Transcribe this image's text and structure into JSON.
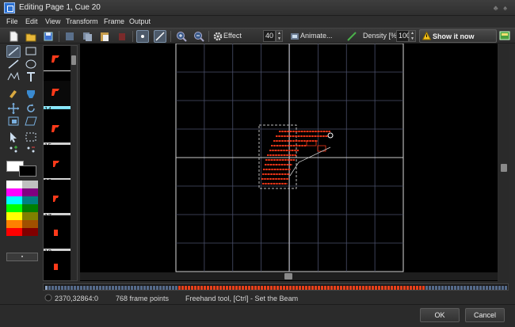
{
  "window": {
    "title": "Editing Page 1, Cue 20"
  },
  "menu": [
    "File",
    "Edit",
    "View",
    "Transform",
    "Frame",
    "Output"
  ],
  "toolbar": {
    "effect_label": "Effect",
    "effect_value": "40",
    "animate_label": "Animate...",
    "density_label": "Density [%]",
    "density_value": "100",
    "show_label": "Show it now"
  },
  "cues": [
    {
      "label": "13",
      "active": false
    },
    {
      "label": "14",
      "active": true
    },
    {
      "label": "15",
      "active": false
    },
    {
      "label": "16",
      "active": false
    },
    {
      "label": "17",
      "active": false
    },
    {
      "label": "18",
      "active": false
    }
  ],
  "palette": [
    "#ffffff",
    "#c0c0c0",
    "#ff00ff",
    "#800080",
    "#00ffff",
    "#008080",
    "#00ff00",
    "#008000",
    "#ffff00",
    "#808000",
    "#ff8000",
    "#a05000",
    "#ff0000",
    "#800000"
  ],
  "status": {
    "coords": "2370,32864:0",
    "points": "768 frame points",
    "hint": "Freehand tool, [Ctrl] - Set the Beam"
  },
  "buttons": {
    "ok": "OK",
    "cancel": "Cancel"
  },
  "colors": {
    "beam": "#ff3a1a",
    "grid": "#4a4f6a",
    "accent": "#2ec3e6"
  }
}
